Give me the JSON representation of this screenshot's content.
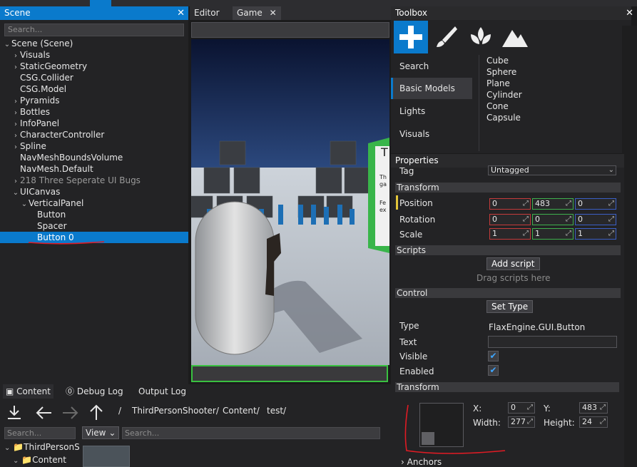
{
  "scene_panel": {
    "title": "Scene",
    "close": "✕",
    "search_placeholder": "Search...",
    "tree": [
      {
        "label": "Scene (Scene)",
        "arrow": "⌄",
        "depth": 0
      },
      {
        "label": "Visuals",
        "arrow": "›",
        "depth": 1
      },
      {
        "label": "StaticGeometry",
        "arrow": "›",
        "depth": 1
      },
      {
        "label": "CSG.Collider",
        "arrow": "",
        "depth": 1
      },
      {
        "label": "CSG.Model",
        "arrow": "",
        "depth": 1
      },
      {
        "label": "Pyramids",
        "arrow": "›",
        "depth": 1
      },
      {
        "label": "Bottles",
        "arrow": "›",
        "depth": 1
      },
      {
        "label": "InfoPanel",
        "arrow": "›",
        "depth": 1
      },
      {
        "label": "CharacterController",
        "arrow": "›",
        "depth": 1
      },
      {
        "label": "Spline",
        "arrow": "›",
        "depth": 1
      },
      {
        "label": "NavMeshBoundsVolume",
        "arrow": "",
        "depth": 1
      },
      {
        "label": "NavMesh.Default",
        "arrow": "",
        "depth": 1
      },
      {
        "label": "218 Three Seperate UI Bugs",
        "arrow": "›",
        "depth": 1
      },
      {
        "label": "UICanvas",
        "arrow": "⌄",
        "depth": 1
      },
      {
        "label": "VerticalPanel",
        "arrow": "⌄",
        "depth": 2
      },
      {
        "label": "Button",
        "arrow": "",
        "depth": 3
      },
      {
        "label": "Spacer",
        "arrow": "",
        "depth": 3
      },
      {
        "label": "Button 0",
        "arrow": "",
        "depth": 3
      }
    ]
  },
  "editor_tabs": {
    "editor": "Editor",
    "game": "Game",
    "close": "✕"
  },
  "viewport": {
    "sign_title": "T",
    "sign_lines": [
      "Th",
      "ga",
      "Fe",
      "ex"
    ]
  },
  "toolbox": {
    "title": "Toolbox",
    "close": "✕",
    "categories": [
      "Search",
      "Basic Models",
      "Lights",
      "Visuals"
    ],
    "models": [
      "Cube",
      "Sphere",
      "Plane",
      "Cylinder",
      "Cone",
      "Capsule"
    ]
  },
  "properties": {
    "title": "Properties",
    "tag_label": "Tag",
    "tag_value": "Untagged",
    "transform_header": "Transform",
    "position_label": "Position",
    "position": [
      "0",
      "483",
      "0"
    ],
    "rotation_label": "Rotation",
    "rotation": [
      "0",
      "0",
      "0"
    ],
    "scale_label": "Scale",
    "scale": [
      "1",
      "1",
      "1"
    ],
    "scripts_header": "Scripts",
    "add_script": "Add script",
    "drag_hint": "Drag scripts here",
    "control_header": "Control",
    "set_type": "Set Type",
    "type_label": "Type",
    "type_value": "FlaxEngine.GUI.Button",
    "text_label": "Text",
    "visible_label": "Visible",
    "enabled_label": "Enabled",
    "transform2_header": "Transform",
    "x_label": "X:",
    "x_value": "0",
    "y_label": "Y:",
    "y_value": "483",
    "width_label": "Width:",
    "width_value": "277",
    "height_label": "Height:",
    "height_value": "24",
    "anchors_label": "Anchors"
  },
  "content_panel": {
    "tabs": [
      "Content",
      "Debug Log",
      "Output Log"
    ],
    "path": [
      "/",
      "ThirdPersonShooter/",
      "Content/",
      "test/"
    ],
    "search_placeholder": "Search...",
    "view_label": "View",
    "tree": [
      "ThirdPersonS",
      "Content"
    ]
  },
  "colors": {
    "accent": "#0a7acc",
    "annotation_red": "#e01b24",
    "highlight_green": "#39c140"
  }
}
